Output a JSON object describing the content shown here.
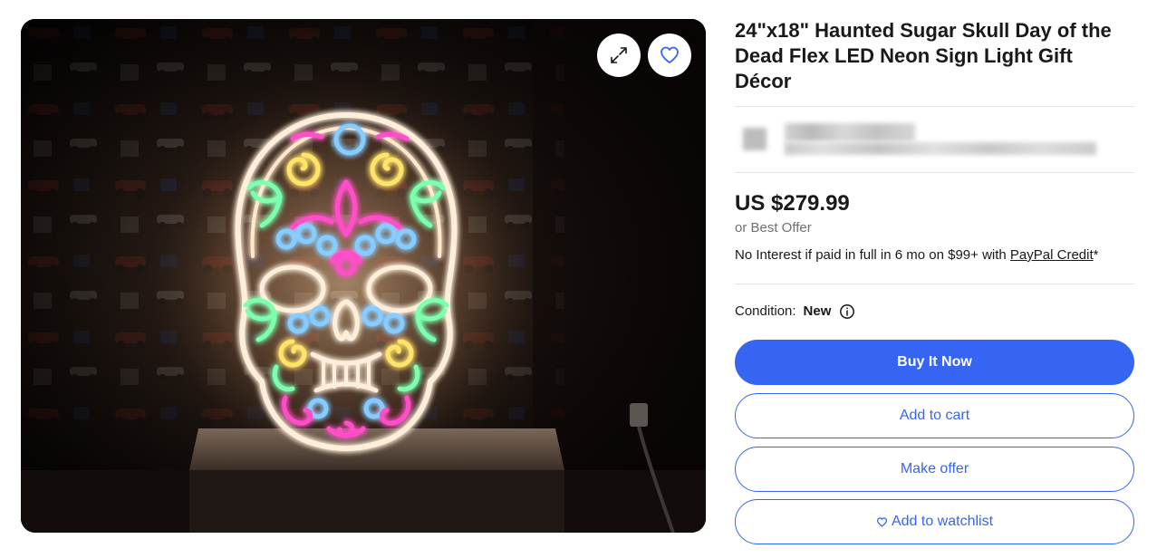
{
  "product": {
    "title": "24\"x18\" Haunted Sugar Skull Day of the Dead Flex LED Neon Sign Light Gift Décor",
    "price": "US $279.99",
    "best_offer": "or Best Offer",
    "financing": {
      "prefix": "No Interest if paid in full in 6 mo on $99+ with ",
      "link": "PayPal Credit",
      "suffix": "*"
    },
    "condition": {
      "label": "Condition:",
      "value": "New"
    }
  },
  "actions": {
    "buy_now": "Buy It Now",
    "add_to_cart": "Add to cart",
    "make_offer": "Make offer",
    "add_to_watchlist": "Add to watchlist"
  },
  "icons": {
    "gallery_expand": "expand-icon",
    "gallery_watch": "heart-icon",
    "condition_info": "info-icon",
    "watchlist_button": "heart-outline-icon"
  },
  "colors": {
    "accent": "#3665f3",
    "text": "#191919",
    "muted": "#707070",
    "divider": "#e5e5e5"
  }
}
